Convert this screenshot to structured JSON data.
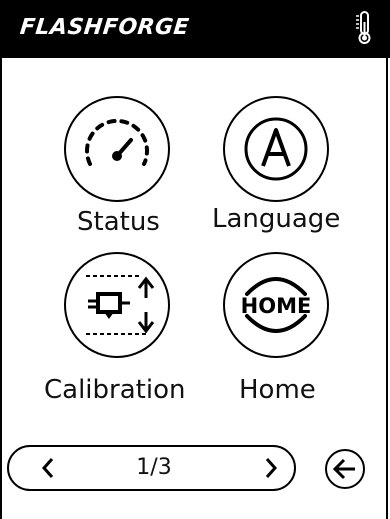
{
  "header": {
    "logo_text": "FLASHFORGE",
    "status_icon": "thermometer-icon"
  },
  "menu": [
    {
      "label": "Status",
      "icon": "speedometer-icon"
    },
    {
      "label": "Language",
      "icon": "language-a-icon"
    },
    {
      "label": "Calibration",
      "icon": "calibration-icon"
    },
    {
      "label": "Home",
      "icon": "home-text-icon",
      "icon_text": "HOME"
    }
  ],
  "pager": {
    "page_text": "1/3",
    "prev_icon": "chevron-left-icon",
    "next_icon": "chevron-right-icon"
  },
  "back": {
    "icon": "back-arrow-icon"
  },
  "colors": {
    "header_bg": "#000000",
    "background": "#ffffff",
    "line": "#000000"
  }
}
